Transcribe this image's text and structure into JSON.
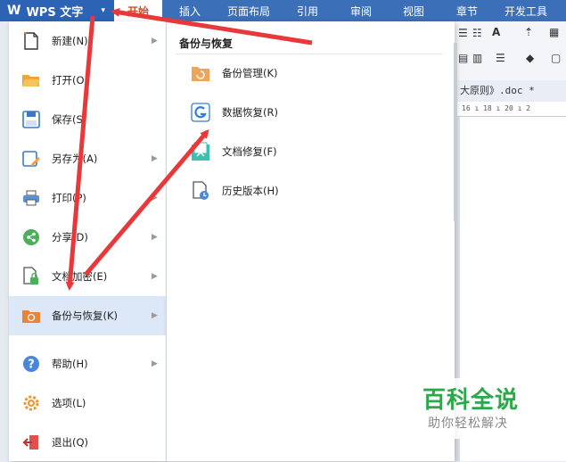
{
  "app": {
    "logo_glyph": "W",
    "title": "WPS 文字",
    "caret": "▾"
  },
  "ribbon_tabs": {
    "active": "开始",
    "items": [
      "插入",
      "页面布局",
      "引用",
      "审阅",
      "视图",
      "章节",
      "开发工具"
    ]
  },
  "document": {
    "tab_title": "大原则》.doc *",
    "ruler": "16 ı 18 ı 20 ı 2"
  },
  "file_menu": {
    "items": [
      {
        "label": "新建(N)",
        "icon": "new-file-icon",
        "has_submenu": true
      },
      {
        "label": "打开(O)",
        "icon": "folder-open-icon",
        "has_submenu": false
      },
      {
        "label": "保存(S)",
        "icon": "save-icon",
        "has_submenu": false
      },
      {
        "label": "另存为(A)",
        "icon": "save-as-icon",
        "has_submenu": true
      },
      {
        "label": "打印(P)",
        "icon": "print-icon",
        "has_submenu": true
      },
      {
        "label": "分享(D)",
        "icon": "share-icon",
        "has_submenu": true
      },
      {
        "label": "文档加密(E)",
        "icon": "document-lock-icon",
        "has_submenu": true
      },
      {
        "label": "备份与恢复(K)",
        "icon": "backup-icon",
        "has_submenu": true,
        "selected": true
      },
      {
        "label": "帮助(H)",
        "icon": "help-icon",
        "has_submenu": true
      },
      {
        "label": "选项(L)",
        "icon": "settings-icon",
        "has_submenu": false
      },
      {
        "label": "退出(Q)",
        "icon": "exit-icon",
        "has_submenu": false
      }
    ]
  },
  "submenu": {
    "title": "备份与恢复",
    "items": [
      {
        "label": "备份管理(K)",
        "icon": "backup-manage-icon"
      },
      {
        "label": "数据恢复(R)",
        "icon": "data-recovery-icon"
      },
      {
        "label": "文档修复(F)",
        "icon": "document-repair-icon"
      },
      {
        "label": "历史版本(H)",
        "icon": "history-version-icon"
      }
    ]
  },
  "watermark": {
    "title": "百科全说",
    "subtitle": "助你轻松解决"
  },
  "colors": {
    "ribbon_blue": "#3b6fb8",
    "active_tab_text": "#d04a2a",
    "selected_item_bg": "#dce8f8",
    "annotation_arrow": "#e8383a",
    "watermark_green": "#2ca84a"
  }
}
